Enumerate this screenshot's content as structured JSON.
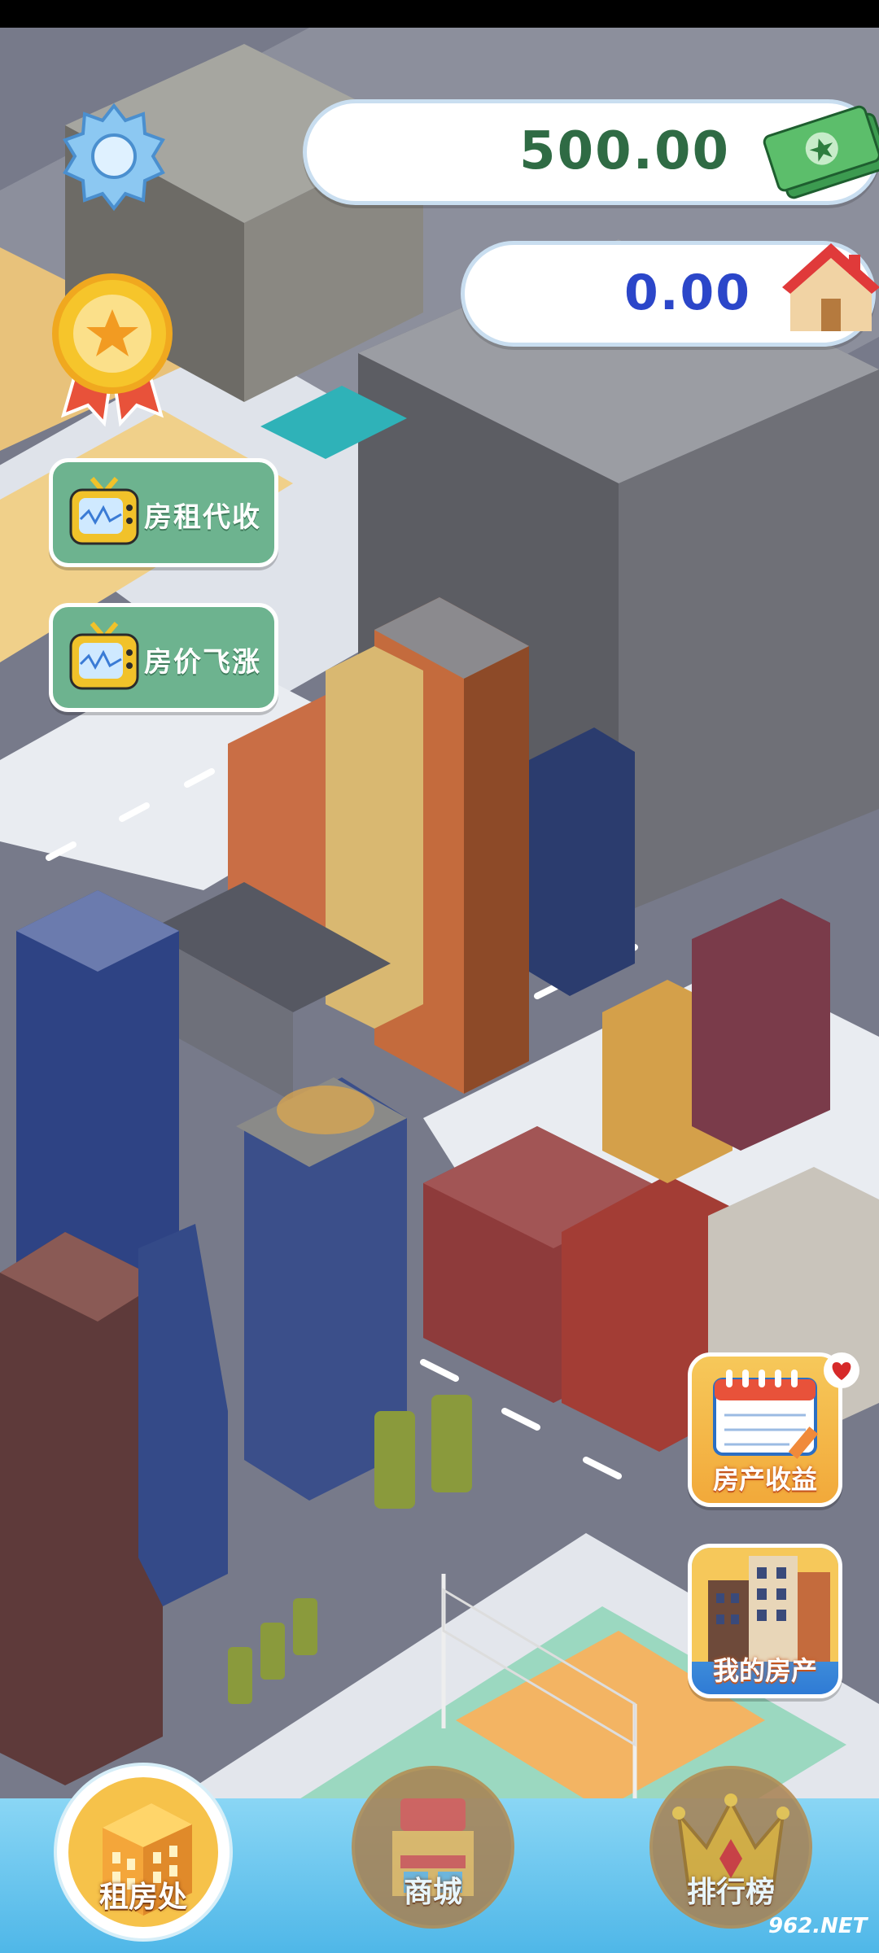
{
  "currency": {
    "money": "500.00",
    "property": "0.00"
  },
  "left_buttons": [
    {
      "label": "房租代收"
    },
    {
      "label": "房价飞涨"
    }
  ],
  "right_buttons": [
    {
      "label": "房产收益"
    },
    {
      "label": "我的房产"
    }
  ],
  "bottom_nav": [
    {
      "label": "租房处"
    },
    {
      "label": "商城"
    },
    {
      "label": "排行榜"
    }
  ],
  "watermark": "962.NET",
  "icons": [
    "gear-icon",
    "medal-icon",
    "money-icon",
    "house-icon",
    "tv-icon",
    "calendar-icon",
    "building-icon",
    "shop-icon",
    "crown-icon",
    "heart-icon"
  ],
  "colors": {
    "money": "#2f6b44",
    "property": "#2b46c9",
    "tv_button": "#6db38f",
    "nav_bar": "#59bde9"
  }
}
